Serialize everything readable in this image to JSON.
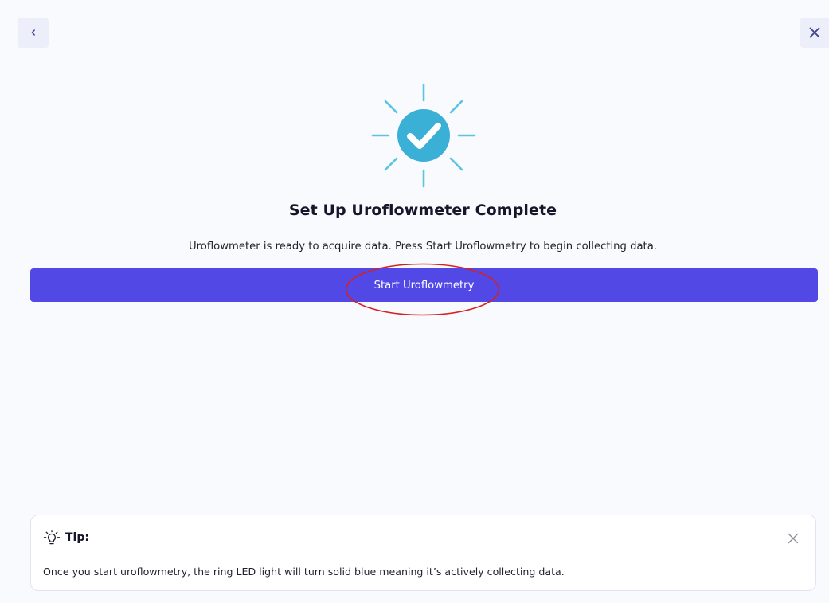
{
  "header": {
    "back_icon": "chevron-left-icon",
    "close_icon": "close-icon"
  },
  "status": {
    "icon": "success-check-icon",
    "title": "Set Up Uroflowmeter Complete",
    "message": "Uroflowmeter is ready to acquire data. Press Start Uroflowmetry to begin collecting data."
  },
  "actions": {
    "start_label": "Start Uroflowmetry"
  },
  "tip": {
    "icon": "lightbulb-icon",
    "title": "Tip:",
    "text": "Once you start uroflowmetry, the ring LED light will turn solid blue meaning it’s actively collecting data.",
    "dismiss_icon": "close-icon"
  },
  "colors": {
    "background": "#f9fafd",
    "primary": "#5148e6",
    "success": "#3ab0d6",
    "success_rays": "#5bc4e2",
    "annotation": "#d62020"
  }
}
